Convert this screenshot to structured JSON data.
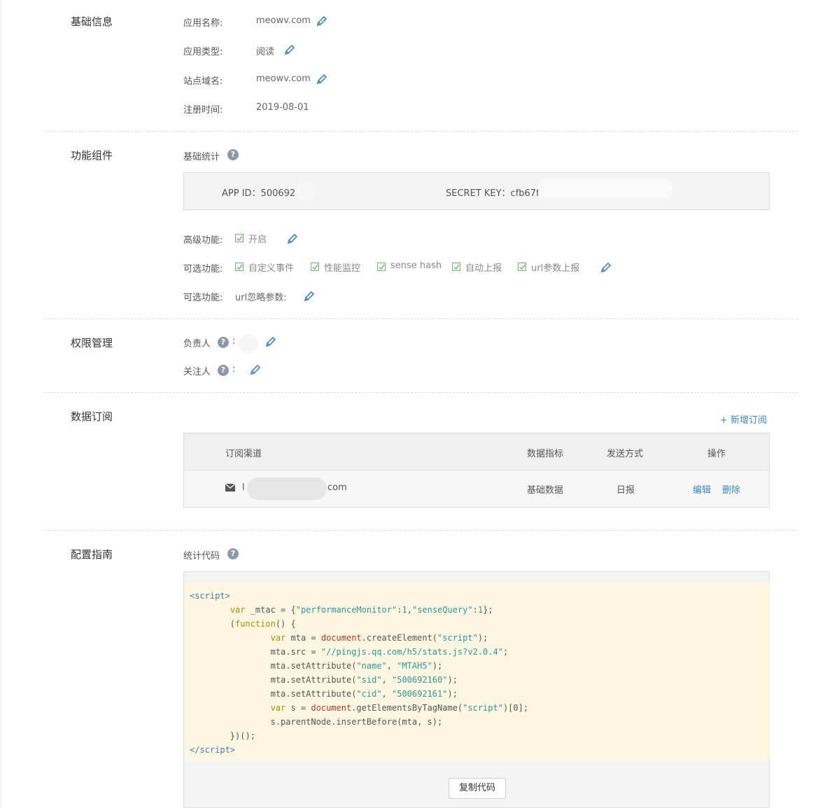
{
  "basic": {
    "title": "基础信息",
    "app_name_label": "应用名称:",
    "app_name": "meowv.com",
    "app_type_label": "应用类型:",
    "app_type": "阅读",
    "domain_label": "站点域名:",
    "domain": "meowv.com",
    "reg_label": "注册时间:",
    "reg_date": "2019-08-01"
  },
  "components": {
    "title": "功能组件",
    "basic_stats_label": "基础统计",
    "app_id": "APP ID：500692",
    "secret_key": "SECRET KEY：cfb67f",
    "advanced_label": "高级功能:",
    "advanced_options": [
      "开启"
    ],
    "optional_label": "可选功能:",
    "optional_options": [
      "自定义事件",
      "性能监控",
      "sense hash",
      "自动上报",
      "url参数上报"
    ],
    "ignore_label": "可选功能:",
    "ignore_value": "url忽略参数:"
  },
  "permissions": {
    "title": "权限管理",
    "owner_label": "负责人",
    "follower_label": "关注人",
    "colon": ":"
  },
  "subscription": {
    "title": "数据订阅",
    "add_link": "+ 新增订阅",
    "columns": [
      "订阅渠道",
      "数据指标",
      "发送方式",
      "操作"
    ],
    "row": {
      "channel_prefix": "l",
      "channel_suffix": "com",
      "metric": "基础数据",
      "method": "日报",
      "edit": "编辑",
      "delete": "删除"
    }
  },
  "config": {
    "title": "配置指南",
    "stats_code_label": "统计代码",
    "copy_button": "复制代码"
  },
  "colors": {
    "accent": "#3a87c8",
    "check": "#6fb56f",
    "code_bg": "#fcf6e1"
  }
}
